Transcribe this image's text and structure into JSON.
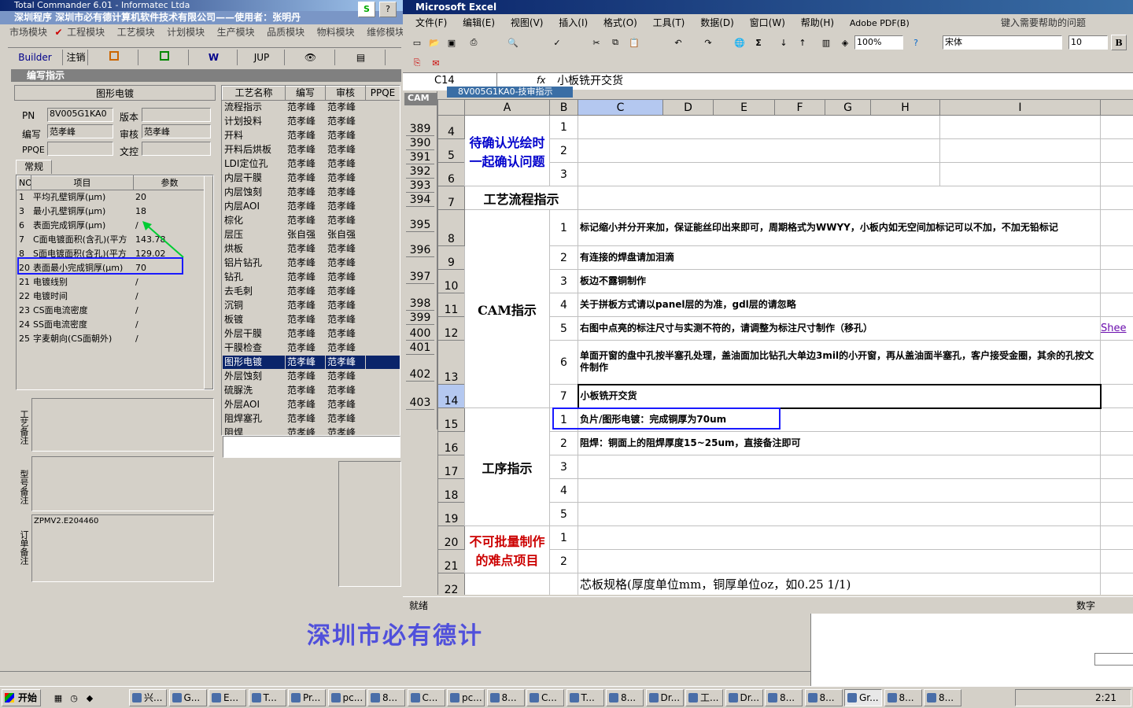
{
  "left_app": {
    "tc_title": "Total Commander 6.01 - Informatec Ltda",
    "title": "深圳程序   深圳市必有德计算机软件技术有限公司——使用者：张明丹",
    "menu": [
      "市场模块",
      "工程模块",
      "工艺模块",
      "计划模块",
      "生产模块",
      "品质模块",
      "物料模块",
      "维修模块"
    ],
    "toolbar": [
      "Builder",
      "注销",
      "",
      "",
      "W",
      "JUP",
      "",
      "",
      ""
    ],
    "subwindow_title": "编写指示",
    "panel_title": "图形电镀",
    "fields": {
      "pn_label": "PN",
      "pn_value": "8V005G1KA0",
      "version_label": "版本",
      "version_value": "",
      "writer_label": "编写",
      "writer_value": "范孝峰",
      "reviewer_label": "审核",
      "reviewer_value": "范孝峰",
      "ppqe_label": "PPQE",
      "ppqe_value": "",
      "wenkong_label": "文控",
      "wenkong_value": ""
    },
    "tab": "常规",
    "param_headers": [
      "NO",
      "项目",
      "参数"
    ],
    "params": [
      [
        "1",
        "平均孔壁铜厚(μm)",
        "20"
      ],
      [
        "3",
        "最小孔壁铜厚(μm)",
        "18"
      ],
      [
        "6",
        "表面完成铜厚(μm)",
        "/"
      ],
      [
        "7",
        "C面电镀面积(含孔)(平方",
        "143.78"
      ],
      [
        "8",
        "S面电镀面积(含孔)(平方",
        "129.02"
      ],
      [
        "20",
        "表面最小完成铜厚(μm)",
        "70"
      ],
      [
        "21",
        "电镀线别",
        "/"
      ],
      [
        "22",
        "电镀时间",
        "/"
      ],
      [
        "23",
        "CS面电流密度",
        "/"
      ],
      [
        "24",
        "SS面电流密度",
        "/"
      ],
      [
        "25",
        "字麦朝向(CS面朝外)",
        "/"
      ]
    ],
    "notes": [
      {
        "label": "工艺备注",
        "value": ""
      },
      {
        "label": "型号备注",
        "value": ""
      },
      {
        "label": "订单备注",
        "value": "ZPMV2.E204460"
      }
    ],
    "process_headers": [
      "工艺名称",
      "编写",
      "审核",
      "PPQE"
    ],
    "process_rows": [
      [
        "流程指示",
        "范孝峰",
        "范孝峰"
      ],
      [
        "计划投料",
        "范孝峰",
        "范孝峰"
      ],
      [
        "开料",
        "范孝峰",
        "范孝峰"
      ],
      [
        "开料后烘板",
        "范孝峰",
        "范孝峰"
      ],
      [
        "LDI定位孔",
        "范孝峰",
        "范孝峰"
      ],
      [
        "内层干膜",
        "范孝峰",
        "范孝峰"
      ],
      [
        "内层蚀刻",
        "范孝峰",
        "范孝峰"
      ],
      [
        "内层AOI",
        "范孝峰",
        "范孝峰"
      ],
      [
        "棕化",
        "范孝峰",
        "范孝峰"
      ],
      [
        "层压",
        "张自强",
        "张自强"
      ],
      [
        "烘板",
        "范孝峰",
        "范孝峰"
      ],
      [
        "铝片钻孔",
        "范孝峰",
        "范孝峰"
      ],
      [
        "钻孔",
        "范孝峰",
        "范孝峰"
      ],
      [
        "去毛刺",
        "范孝峰",
        "范孝峰"
      ],
      [
        "沉铜",
        "范孝峰",
        "范孝峰"
      ],
      [
        "板镀",
        "范孝峰",
        "范孝峰"
      ],
      [
        "外层干膜",
        "范孝峰",
        "范孝峰"
      ],
      [
        "干膜检查",
        "范孝峰",
        "范孝峰"
      ],
      [
        "图形电镀",
        "范孝峰",
        "范孝峰"
      ],
      [
        "外层蚀刻",
        "范孝峰",
        "范孝峰"
      ],
      [
        "硫脲洗",
        "范孝峰",
        "范孝峰"
      ],
      [
        "外层AOI",
        "范孝峰",
        "范孝峰"
      ],
      [
        "阻焊塞孔",
        "范孝峰",
        "范孝峰"
      ],
      [
        "阻焊",
        "范孝峰",
        "范孝峰"
      ]
    ],
    "watermark": "深圳市必有德计"
  },
  "excel": {
    "title": "Microsoft Excel",
    "menu": [
      "文件(F)",
      "编辑(E)",
      "视图(V)",
      "插入(I)",
      "格式(O)",
      "工具(T)",
      "数据(D)",
      "窗口(W)",
      "帮助(H)",
      "Adobe PDF(B)"
    ],
    "help_placeholder": "键入需要帮助的问题",
    "zoom": "100%",
    "font": "宋体",
    "font_size": "10",
    "name_box": "C14",
    "formula": "小板铣开交货",
    "sheet_title": "8V005G1KA0-技审指示",
    "side_label": "CAM",
    "columns": [
      "A",
      "B",
      "C",
      "D",
      "E",
      "F",
      "G",
      "H",
      "I"
    ],
    "left_rows": [
      "389",
      "390",
      "391",
      "392",
      "393",
      "394",
      "395",
      "396",
      "397",
      "398",
      "399",
      "400",
      "401",
      "402",
      "403"
    ],
    "rows": [
      {
        "n": "4",
        "b": "1",
        "c": ""
      },
      {
        "n": "5",
        "b": "2",
        "c": ""
      },
      {
        "n": "6",
        "b": "3",
        "c": ""
      },
      {
        "n": "7",
        "b": "",
        "c": ""
      },
      {
        "n": "8",
        "b": "1",
        "c": "标记缩小并分开来加，保证能丝印出来即可，周期格式为WWYY，小板内如无空间加标记可以不加，不加无铅标记"
      },
      {
        "n": "9",
        "b": "2",
        "c": "有连接的焊盘请加泪滴"
      },
      {
        "n": "10",
        "b": "3",
        "c": "板边不露铜制作"
      },
      {
        "n": "11",
        "b": "4",
        "c": "关于拼板方式请以panel层的为准，gdl层的请忽略"
      },
      {
        "n": "12",
        "b": "5",
        "c": "右图中点亮的标注尺寸与实测不符的，请调整为标注尺寸制作（移孔）"
      },
      {
        "n": "13",
        "b": "6",
        "c": "单面开窗的盘中孔按半塞孔处理，盖油面加比钻孔大单边3mil的小开窗，再从盖油面半塞孔，客户接受金圈，其余的孔按文件制作"
      },
      {
        "n": "14",
        "b": "7",
        "c": "小板铣开交货"
      },
      {
        "n": "15",
        "b": "1",
        "c": "负片/图形电镀：完成铜厚为70um"
      },
      {
        "n": "16",
        "b": "2",
        "c": "阻焊：铜面上的阻焊厚度15~25um，直接备注即可"
      },
      {
        "n": "17",
        "b": "3",
        "c": ""
      },
      {
        "n": "18",
        "b": "4",
        "c": ""
      },
      {
        "n": "19",
        "b": "5",
        "c": ""
      },
      {
        "n": "20",
        "b": "1",
        "c": ""
      },
      {
        "n": "21",
        "b": "2",
        "c": ""
      },
      {
        "n": "22",
        "b": "",
        "c": "芯板规格(厚度单位mm，铜厚单位oz，如0.25 1/1)"
      }
    ],
    "sections": {
      "confirm": "待确认光绘时一起确认问题",
      "process_flow": "工艺流程指示",
      "cam": "CAM指示",
      "operation": "工序指示",
      "difficult": "不可批量制作的难点项目"
    },
    "sheet_link": "Shee",
    "status_left": "就绪",
    "status_right": "数字"
  },
  "taskbar": {
    "start": "开始",
    "items": [
      "兴...",
      "G...",
      "E...",
      "T...",
      "Pr...",
      "pc...",
      "8...",
      "C...",
      "pc...",
      "8...",
      "C...",
      "T...",
      "8...",
      "Dr...",
      "工...",
      "Dr...",
      "8...",
      "8...",
      "Gr...",
      "8...",
      "8..."
    ],
    "clock": "2:21"
  }
}
